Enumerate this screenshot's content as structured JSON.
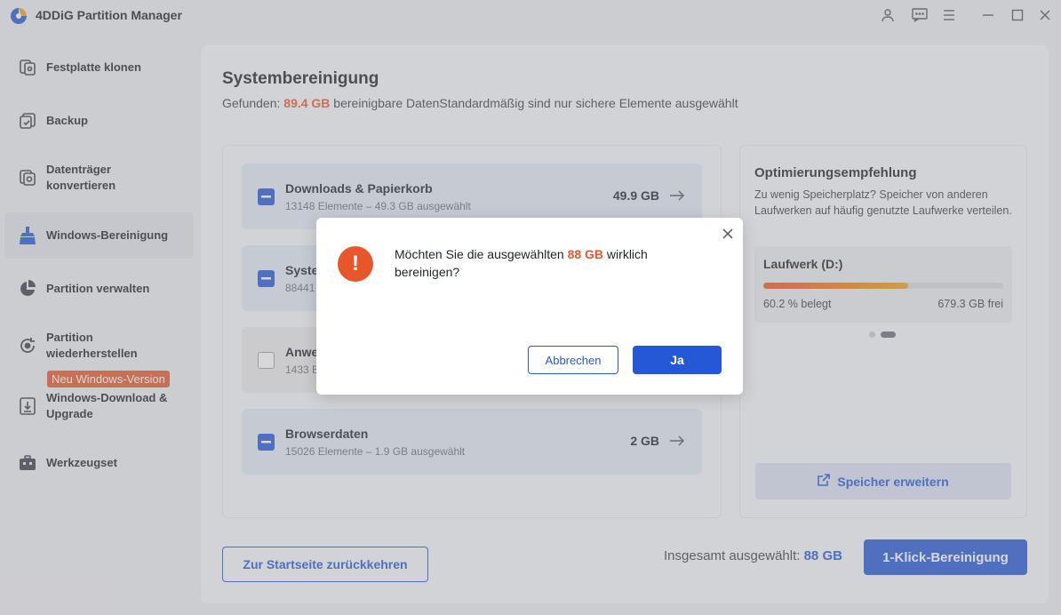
{
  "app": {
    "title": "4DDiG Partition Manager"
  },
  "sidebar": {
    "items": [
      {
        "label": "Festplatte klonen",
        "icon": "clone-disk-icon"
      },
      {
        "label": "Backup",
        "icon": "backup-icon"
      },
      {
        "label_line1": "Datenträger",
        "label_line2": "konvertieren",
        "icon": "convert-disk-icon"
      },
      {
        "label": "Windows-Bereinigung",
        "icon": "cleanup-icon",
        "active": true
      },
      {
        "label": "Partition verwalten",
        "icon": "pie-chart-icon"
      },
      {
        "label_line1": "Partition",
        "label_line2": "wiederherstellen",
        "icon": "restore-partition-icon"
      },
      {
        "label_line1": "Windows-Download &",
        "label_line2": "Upgrade",
        "icon": "windows-download-icon",
        "badge": "Neu Windows-Version"
      },
      {
        "label": "Werkzeugset",
        "icon": "toolbox-icon"
      }
    ]
  },
  "main": {
    "title": "Systembereinigung",
    "found_prefix": "Gefunden: ",
    "found_amount": "89.4 GB",
    "found_suffix": " bereinigbare DatenStandardmäßig sind nur sichere Elemente ausgewählt",
    "categories": [
      {
        "name": "Downloads & Papierkorb",
        "sub": "13148 Elemente – 49.3 GB ausgewählt",
        "size": "49.9 GB",
        "checked": "partial"
      },
      {
        "name": "Syste",
        "sub": "88441",
        "size": "",
        "checked": "partial"
      },
      {
        "name": "Anwe",
        "sub": "1433 E",
        "size": "",
        "checked": "none"
      },
      {
        "name": "Browserdaten",
        "sub": "15026 Elemente – 1.9 GB ausgewählt",
        "size": "2 GB",
        "checked": "partial"
      }
    ],
    "recommendation": {
      "title": "Optimierungsempfehlung",
      "description": "Zu wenig Speicherplatz? Speicher von anderen Laufwerken auf häufig genutzte Laufwerke verteilen.",
      "drive": {
        "name": "Laufwerk (D:)",
        "used_fraction": 0.602,
        "used_label": "60.2 % belegt",
        "free_label": "679.3 GB frei"
      },
      "expand_label": "Speicher erweitern"
    },
    "back_label": "Zur Startseite zurückkehren",
    "total_prefix": "Insgesamt ausgewählt: ",
    "total_amount": "88 GB",
    "clean_label": "1-Klick-Bereinigung"
  },
  "dialog": {
    "msg_prefix": "Möchten Sie die ausgewählten ",
    "msg_amount": "88 GB",
    "msg_suffix": " wirklich bereinigen?",
    "cancel_label": "Abbrechen",
    "ok_label": "Ja"
  },
  "colors": {
    "accent": "#2458d6",
    "warning": "#e8572c"
  }
}
